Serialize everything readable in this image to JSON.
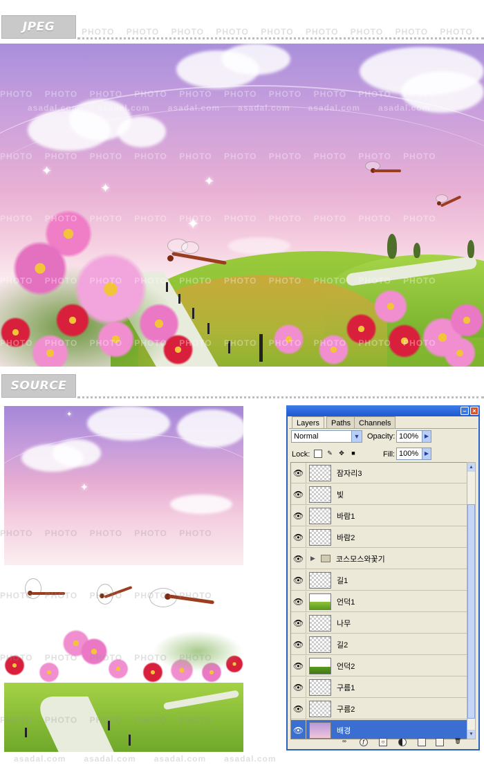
{
  "sections": {
    "top_label": "JPEG",
    "bottom_label": "SOURCE"
  },
  "watermarks": {
    "photo": "PHOTO",
    "site": "asadal.com"
  },
  "panel": {
    "tabs": [
      "Layers",
      "Paths",
      "Channels"
    ],
    "blend_mode": "Normal",
    "opacity_label": "Opacity:",
    "opacity_value": "100%",
    "lock_label": "Lock:",
    "fill_label": "Fill:",
    "fill_value": "100%",
    "layers": [
      {
        "name": "잠자리3",
        "thumb": "checker",
        "selected": false
      },
      {
        "name": "빛",
        "thumb": "checker",
        "selected": false
      },
      {
        "name": "바람1",
        "thumb": "checker",
        "selected": false
      },
      {
        "name": "바람2",
        "thumb": "checker",
        "selected": false
      },
      {
        "name": "코스모스와꽃기",
        "thumb": "folder",
        "selected": false
      },
      {
        "name": "길1",
        "thumb": "checker",
        "selected": false
      },
      {
        "name": "언덕1",
        "thumb": "grass",
        "selected": false
      },
      {
        "name": "나무",
        "thumb": "checker",
        "selected": false
      },
      {
        "name": "길2",
        "thumb": "checker",
        "selected": false
      },
      {
        "name": "언덕2",
        "thumb": "grass2",
        "selected": false
      },
      {
        "name": "구름1",
        "thumb": "checker",
        "selected": false
      },
      {
        "name": "구름2",
        "thumb": "checker",
        "selected": false
      },
      {
        "name": "배경",
        "thumb": "bg",
        "selected": true
      }
    ]
  },
  "colors": {
    "sky_top": "#a98fdc",
    "sky_pink": "#e8b0d4",
    "grass": "#8ec23a",
    "panel_bg": "#ece9d8",
    "selection": "#3a6fd1"
  }
}
